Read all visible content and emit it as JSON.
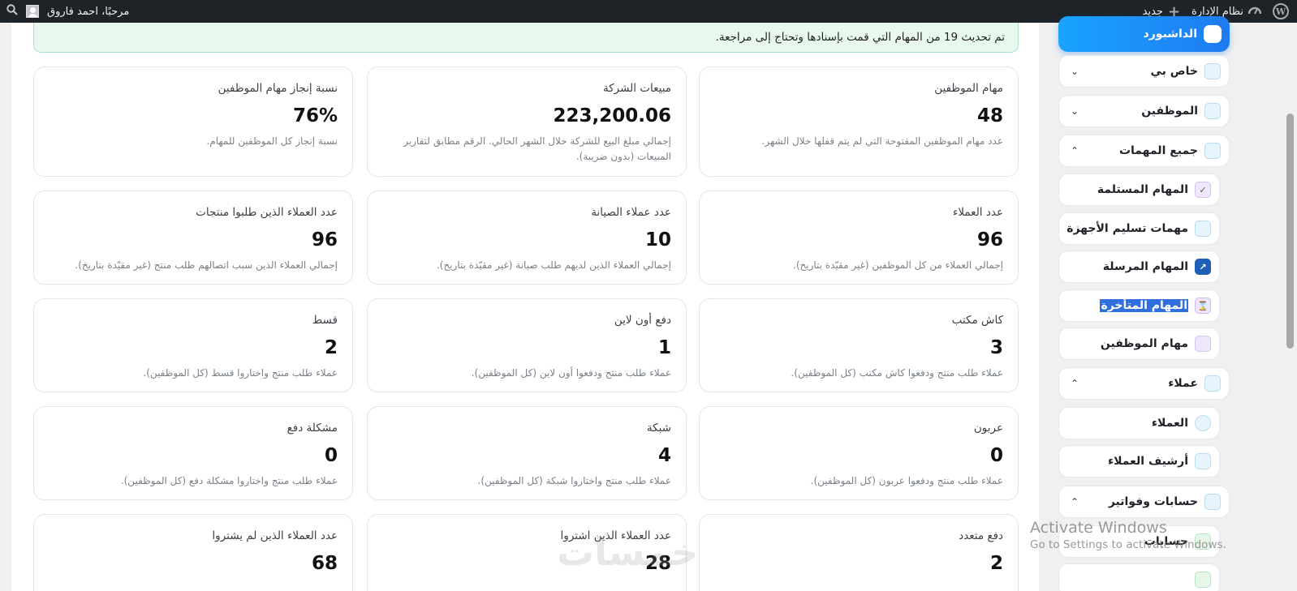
{
  "adminbar": {
    "site_name": "نظام الإدارة",
    "new_label": "جديد",
    "greeting": "مرحبًا، احمد فاروق"
  },
  "notice": "تم تحديث 19 من المهام التي قمت بإسنادها وتحتاج إلى مراجعة.",
  "cards": [
    {
      "title": "مهام الموظفين",
      "value": "48",
      "desc": "عدد مهام الموظفين المفتوحة التي لم يتم قفلها خلال الشهر."
    },
    {
      "title": "مبيعات الشركة",
      "value": "223,200.06",
      "desc": "إجمالي مبلغ البيع للشركة خلال الشهر الحالي. الرقم مطابق لتقارير المبيعات (بدون ضريبة)."
    },
    {
      "title": "نسبة إنجاز مهام الموظفين",
      "value": "76%",
      "desc": "نسبة إنجاز كل الموظفين للمهام."
    },
    {
      "title": "عدد العملاء",
      "value": "96",
      "desc": "إجمالي العملاء من كل الموظفين (غير مقيّدة بتاريخ)."
    },
    {
      "title": "عدد عملاء الصيانة",
      "value": "10",
      "desc": "إجمالي العملاء الذين لديهم طلب صيانة (غير مقيّدة بتاريخ)."
    },
    {
      "title": "عدد العملاء الذين طلبوا منتجات",
      "value": "96",
      "desc": "إجمالي العملاء الذين سبب اتصالهم طلب منتج (غير مقيّدة بتاريخ)."
    },
    {
      "title": "كاش مكتب",
      "value": "3",
      "desc": "عملاء طلب منتج ودفعوا كاش مكتب (كل الموظفين)."
    },
    {
      "title": "دفع أون لاين",
      "value": "1",
      "desc": "عملاء طلب منتج ودفعوا أون لاين (كل الموظفين)."
    },
    {
      "title": "قسط",
      "value": "2",
      "desc": "عملاء طلب منتج واختاروا قسط (كل الموظفين)."
    },
    {
      "title": "عربون",
      "value": "0",
      "desc": "عملاء طلب منتج ودفعوا عربون (كل الموظفين)."
    },
    {
      "title": "شبكة",
      "value": "4",
      "desc": "عملاء طلب منتج واختاروا شبكة (كل الموظفين)."
    },
    {
      "title": "مشكلة دفع",
      "value": "0",
      "desc": "عملاء طلب منتج واختاروا مشكلة دفع (كل الموظفين)."
    },
    {
      "title": "دفع متعدد",
      "value": "2",
      "desc": ""
    },
    {
      "title": "عدد العملاء الذين اشتروا",
      "value": "28",
      "desc": ""
    },
    {
      "title": "عدد العملاء الذين لم يشتروا",
      "value": "68",
      "desc": ""
    }
  ],
  "sidebar": {
    "items": [
      {
        "label": "الداشبورد",
        "icon": "dashboard-icon"
      },
      {
        "label": "خاص بي",
        "icon": "folder-icon",
        "chevron": "⌄"
      },
      {
        "label": "الموظفين",
        "icon": "users-icon",
        "chevron": "⌄"
      },
      {
        "label": "جميع المهمات",
        "icon": "tasks-icon",
        "chevron": "⌃"
      },
      {
        "label": "المهام المستلمة",
        "icon": "check-icon"
      },
      {
        "label": "مهمات تسليم الأجهزة",
        "icon": "device-icon"
      },
      {
        "label": "المهام المرسلة",
        "icon": "send-icon"
      },
      {
        "label": "المهام المتأخرة",
        "icon": "hourglass-icon"
      },
      {
        "label": "مهام الموظفين",
        "icon": "list-icon"
      },
      {
        "label": "عملاء",
        "icon": "clients-icon",
        "chevron": "⌃"
      },
      {
        "label": "العملاء",
        "icon": "client-icon"
      },
      {
        "label": "أرشيف العملاء",
        "icon": "archive-icon"
      },
      {
        "label": "حسابات وفواتير",
        "icon": "invoice-icon",
        "chevron": "⌃"
      },
      {
        "label": "حسابات",
        "icon": "accounts-icon"
      }
    ]
  },
  "overlay": {
    "activate_title": "Activate Windows",
    "activate_sub": "Go to Settings to activate Windows.",
    "watermark": "خمسات"
  }
}
